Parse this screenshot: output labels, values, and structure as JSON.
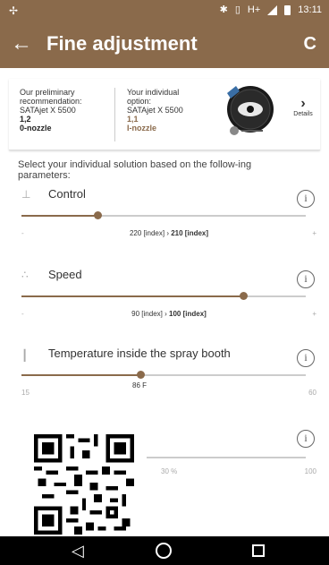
{
  "status_bar": {
    "time": "13:11",
    "network": "H+"
  },
  "app_bar": {
    "title": "Fine adjustment",
    "back_icon": "←",
    "refresh_icon": "C"
  },
  "recommendation": {
    "left": {
      "line1": "Our preliminary",
      "line2": "recommendation:",
      "product": "SATAjet X 5500",
      "size": "1,2",
      "nozzle": "0-nozzle"
    },
    "right": {
      "line1": "Your individual",
      "line2": "option:",
      "product": "SATAjet X 5500",
      "size": "1,1",
      "nozzle": "I-nozzle"
    },
    "details_label": "Details"
  },
  "intro": "Select your individual solution based on the follow-ing parameters:",
  "params": {
    "control": {
      "label": "Control",
      "value_text": "220 [index]",
      "arrow": "›",
      "new_value": "210 [index]",
      "min": "-",
      "max": "+",
      "level": 0.27
    },
    "speed": {
      "label": "Speed",
      "value_text": "90 [index]",
      "arrow": "›",
      "new_value": "100 [index]",
      "min": "-",
      "max": "+",
      "level": 0.78
    },
    "temperature": {
      "label": "Temperature inside the spray booth",
      "value_text": "86 F",
      "min": "15",
      "max": "60",
      "level": 0.42
    },
    "humidity": {
      "value_text": "30 %",
      "max": "100",
      "level": 0.3
    }
  },
  "colors": {
    "brand": "#8a6a4b"
  }
}
